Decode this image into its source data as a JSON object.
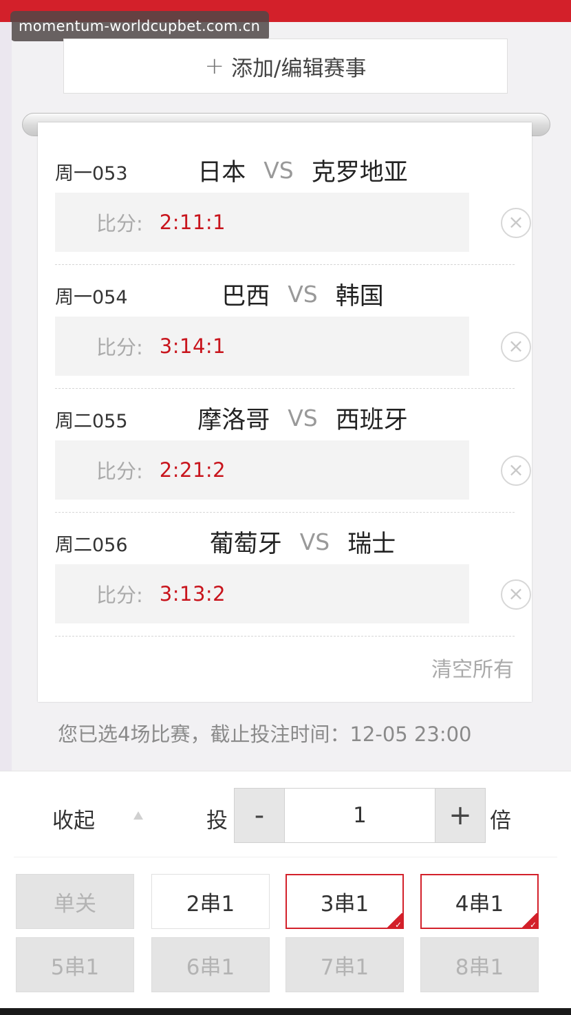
{
  "header": {
    "watermark": "momentum-worldcupbet.com.cn"
  },
  "add_button": {
    "icon": "plus-icon",
    "label": "添加/编辑赛事"
  },
  "matches": [
    {
      "code": "周一053",
      "home": "日本",
      "vs": "VS",
      "away": "克罗地亚",
      "score_label": "比分:",
      "score": "2:11:1"
    },
    {
      "code": "周一054",
      "home": "巴西",
      "vs": "VS",
      "away": "韩国",
      "score_label": "比分:",
      "score": "3:14:1"
    },
    {
      "code": "周二055",
      "home": "摩洛哥",
      "vs": "VS",
      "away": "西班牙",
      "score_label": "比分:",
      "score": "2:21:2"
    },
    {
      "code": "周二056",
      "home": "葡萄牙",
      "vs": "VS",
      "away": "瑞士",
      "score_label": "比分:",
      "score": "3:13:2"
    }
  ],
  "clear_all": "清空所有",
  "summary": "您已选4场比赛，截止投注时间：12-05 23:00",
  "bottom_panel": {
    "collapse_label": "收起",
    "bet_label": "投",
    "minus": "-",
    "plus": "+",
    "multiplier_value": "1",
    "multiplier_unit": "倍"
  },
  "combos": [
    {
      "label": "单关",
      "state": "disabled"
    },
    {
      "label": "2串1",
      "state": "normal"
    },
    {
      "label": "3串1",
      "state": "selected"
    },
    {
      "label": "4串1",
      "state": "selected"
    },
    {
      "label": "5串1",
      "state": "disabled"
    },
    {
      "label": "6串1",
      "state": "disabled"
    },
    {
      "label": "7串1",
      "state": "disabled"
    },
    {
      "label": "8串1",
      "state": "disabled"
    }
  ],
  "colors": {
    "accent": "#d3202a",
    "score": "#c8141c"
  }
}
